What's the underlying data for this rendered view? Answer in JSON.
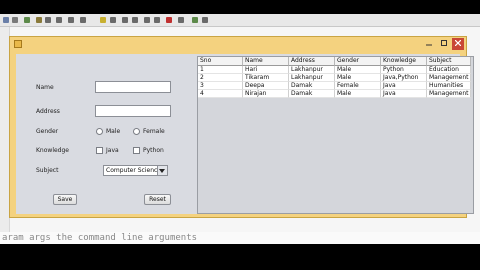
{
  "ide": {
    "code_fragment": "aram args the command line arguments"
  },
  "window": {
    "title": "",
    "controls": {
      "minimize": "–",
      "maximize": "□",
      "close": "✕"
    }
  },
  "form": {
    "name_label": "Name",
    "address_label": "Address",
    "gender_label": "Gender",
    "gender_options": [
      "Male",
      "Female"
    ],
    "knowledge_label": "Knowledge",
    "knowledge_options": [
      "Java",
      "Python"
    ],
    "subject_label": "Subject",
    "subject_selected": "Computer Science",
    "save_label": "Save",
    "reset_label": "Reset"
  },
  "table": {
    "columns": [
      "Sno",
      "Name",
      "Address",
      "Gender",
      "Knowledge",
      "Subject"
    ],
    "rows": [
      [
        "1",
        "Hari",
        "Lakhanpur",
        "Male",
        "Python",
        "Education"
      ],
      [
        "2",
        "Tikaram",
        "Lakhanpur",
        "Male",
        "Java,Python",
        "Management"
      ],
      [
        "3",
        "Deepa",
        "Damak",
        "Female",
        "Java",
        "Humanities"
      ],
      [
        "4",
        "Nirajan",
        "Damak",
        "Male",
        "Java",
        "Management"
      ]
    ]
  }
}
